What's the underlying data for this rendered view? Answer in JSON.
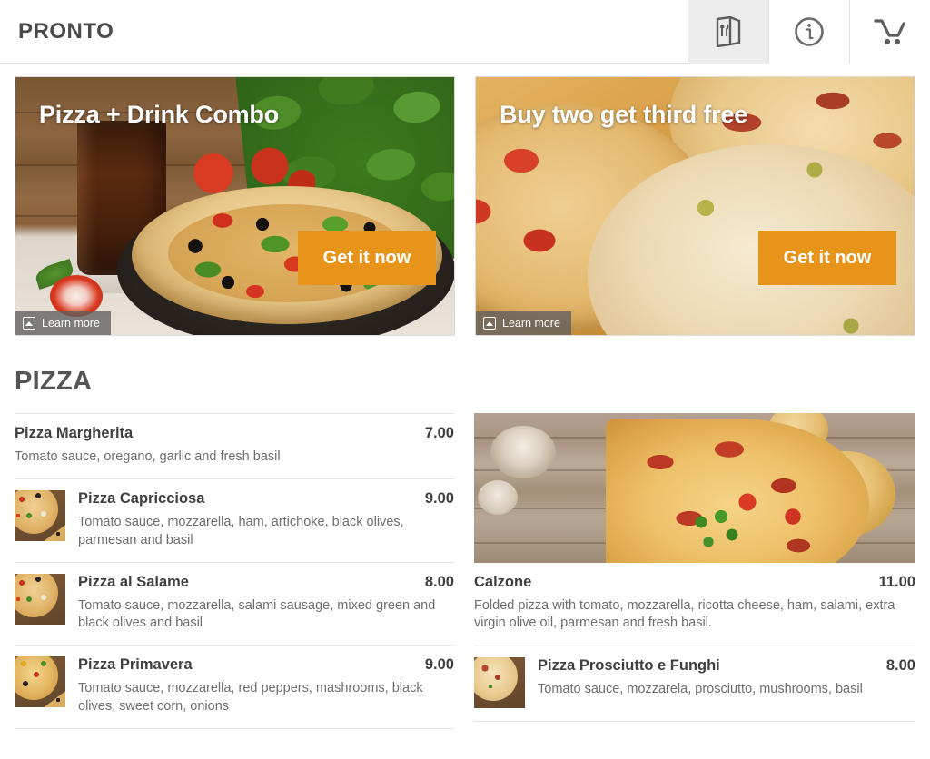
{
  "header": {
    "brand": "PRONTO",
    "tabs": [
      {
        "name": "menu-tab",
        "icon": "menu-book-icon",
        "active": true
      },
      {
        "name": "info-tab",
        "icon": "info-circle-icon",
        "active": false
      },
      {
        "name": "cart-tab",
        "icon": "shopping-cart-icon",
        "active": false
      }
    ]
  },
  "banners": [
    {
      "title": "Pizza + Drink Combo",
      "cta": "Get it now",
      "learn_more": "Learn more",
      "adchoices_icon": "adchoices-icon",
      "image_alt": "pizza-with-cola-glass-and-basil"
    },
    {
      "title": "Buy two get third free",
      "cta": "Get it now",
      "learn_more": "Learn more",
      "adchoices_icon": "adchoices-icon",
      "image_alt": "three-pizzas-on-wooden-board"
    }
  ],
  "section": {
    "title": "PIZZA"
  },
  "left_items": [
    {
      "name": "Pizza Margherita",
      "price": "7.00",
      "description": "Tomato sauce, oregano, garlic and fresh basil",
      "thumb": false
    },
    {
      "name": "Pizza Capricciosa",
      "price": "9.00",
      "description": "Tomato sauce, mozzarella, ham, artichoke, black olives, parmesan and basil",
      "thumb": true
    },
    {
      "name": "Pizza al Salame",
      "price": "8.00",
      "description": "Tomato sauce, mozzarella, salami sausage, mixed green and black olives and basil",
      "thumb": true
    },
    {
      "name": "Pizza Primavera",
      "price": "9.00",
      "description": "Tomato sauce, mozzarella, red peppers, mashrooms, black olives, sweet corn, onions",
      "thumb": true
    }
  ],
  "right_items": [
    {
      "name": "Calzone",
      "price": "11.00",
      "description": "Folded pizza with tomato, mozzarella, ricotta cheese, ham, salami, extra virgin olive oil, parmesan and fresh basil.",
      "hero_image_alt": "calzone-pizza-slices-with-mushrooms-and-onions"
    },
    {
      "name": "Pizza Prosciutto e Funghi",
      "price": "8.00",
      "description": "Tomato sauce, mozzarela, prosciutto, mushrooms, basil",
      "thumb": true
    }
  ],
  "colors": {
    "accent_orange": "#e8941b",
    "text_dark": "#3f3f3f",
    "text_muted": "#6e6e6e",
    "rule": "#e4e4e4",
    "tab_active_bg": "#ececec"
  }
}
